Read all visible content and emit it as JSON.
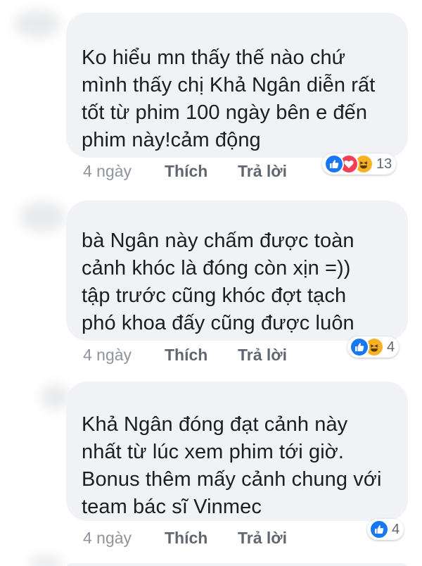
{
  "comments": [
    {
      "text": "Ko hiểu mn thấy thế nào chứ\nmình thấy chị Khả Ngân diễn rất\ntốt từ phim 100 ngày bên e đến\nphim này!cảm động",
      "time": "4 ngày",
      "like_label": "Thích",
      "reply_label": "Trả lời",
      "reactions": [
        "like",
        "love",
        "haha"
      ],
      "reaction_count": "13"
    },
    {
      "text": "bà Ngân này chấm được toàn\ncảnh khóc là đóng còn xịn =))\ntập trước cũng khóc đợt tạch\nphó khoa đấy cũng được luôn",
      "time": "4 ngày",
      "like_label": "Thích",
      "reply_label": "Trả lời",
      "reactions": [
        "like",
        "haha"
      ],
      "reaction_count": "4"
    },
    {
      "text": "Khả Ngân đóng đạt cảnh này\nnhất từ lúc xem phim tới giờ.\nBonus thêm mấy cảnh chung với\nteam bác sĩ Vinmec",
      "time": "4 ngày",
      "like_label": "Thích",
      "reply_label": "Trả lời",
      "reactions": [
        "like"
      ],
      "reaction_count": "4"
    }
  ],
  "colors": {
    "bubble": "#f1f2f5",
    "text": "#1c1e21",
    "meta": "#90949c",
    "like": "#1877f2",
    "love": "#f33e58",
    "haha": "#f7b125"
  }
}
